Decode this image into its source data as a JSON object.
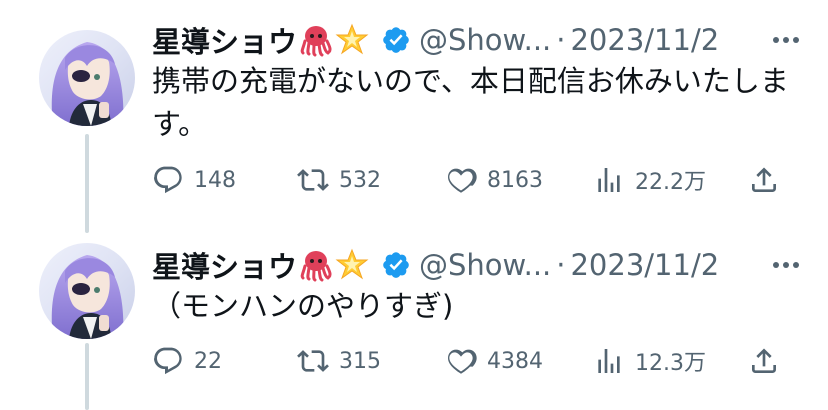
{
  "tweets": [
    {
      "author": {
        "name": "星導ショウ",
        "handle": "@Show...",
        "emojis": [
          "octopus",
          "glowing-star"
        ]
      },
      "separator": "·",
      "date": "2023/11/2",
      "text": "携帯の充電がないので、本日配信お休みいたします。",
      "stats": {
        "replies": "148",
        "retweets": "532",
        "likes": "8163",
        "views": "22.2万"
      }
    },
    {
      "author": {
        "name": "星導ショウ",
        "handle": "@Show...",
        "emojis": [
          "octopus",
          "glowing-star"
        ]
      },
      "separator": "·",
      "date": "2023/11/2",
      "text": "（モンハンのやりすぎ)",
      "stats": {
        "replies": "22",
        "retweets": "315",
        "likes": "4384",
        "views": "12.3万"
      }
    }
  ],
  "colors": {
    "text": "#0f1419",
    "secondary": "#536471",
    "verified": "#1d9bf0",
    "thread_line": "#cfd9de"
  },
  "icons": [
    "reply-icon",
    "retweet-icon",
    "like-icon",
    "views-icon",
    "share-icon",
    "more-icon",
    "verified-badge-icon"
  ]
}
